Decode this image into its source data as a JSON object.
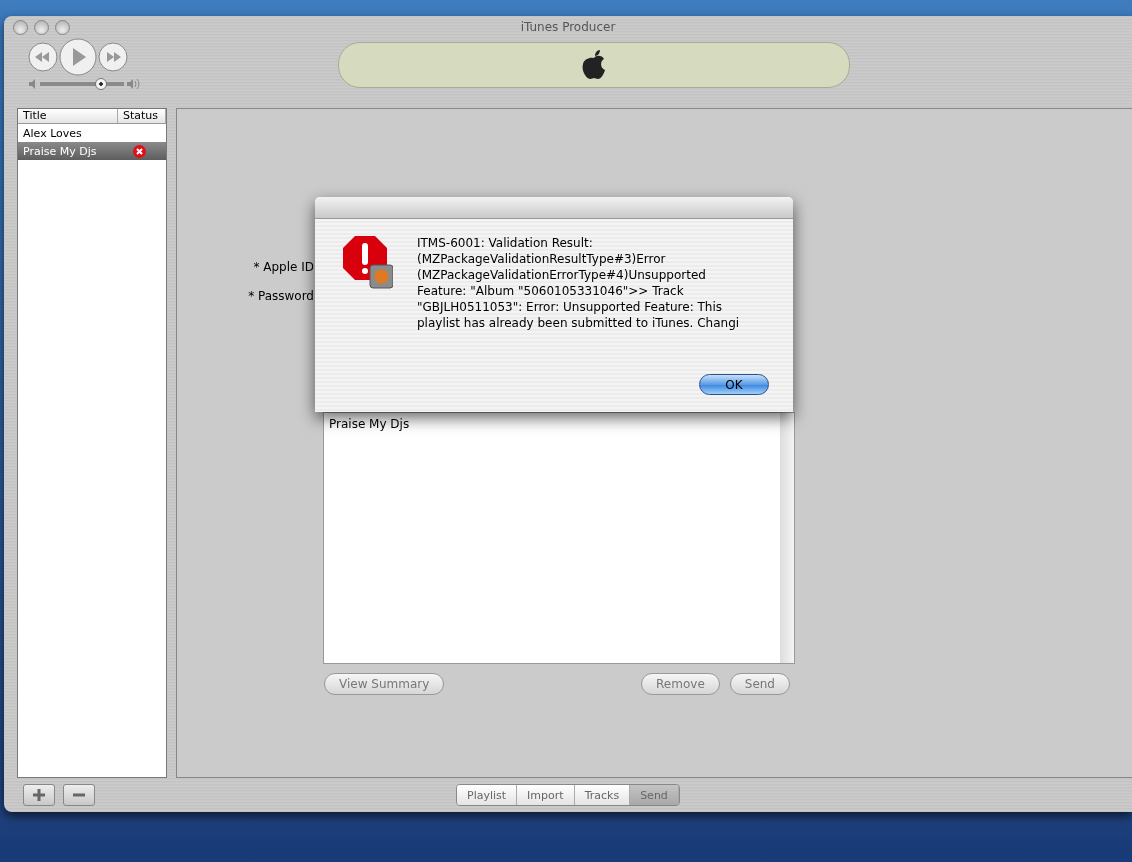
{
  "window": {
    "title": "iTunes Producer"
  },
  "volume": {
    "level": 0.73
  },
  "sidebar": {
    "columns": [
      "Title",
      "Status"
    ],
    "rows": [
      {
        "title": "Alex Loves",
        "error": false,
        "selected": false
      },
      {
        "title": "Praise My Djs",
        "error": true,
        "selected": true
      }
    ]
  },
  "form": {
    "fields": [
      {
        "label": "* Apple ID"
      },
      {
        "label": "* Password"
      }
    ]
  },
  "playlist_box": {
    "items": [
      "Praise My Djs"
    ]
  },
  "actions": {
    "left": [
      "View Summary"
    ],
    "right": [
      "Remove",
      "Send"
    ]
  },
  "bottom_tabs": [
    {
      "label": "Playlist",
      "selected": false
    },
    {
      "label": "Import",
      "selected": false
    },
    {
      "label": "Tracks",
      "selected": false
    },
    {
      "label": "Send",
      "selected": true
    }
  ],
  "dialog": {
    "message": "ITMS-6001: Validation Result: (MZPackageValidationResultType#3)Error (MZPackageValidationErrorType#4)Unsupported Feature: \"Album \"5060105331046\">> Track \"GBJLH0511053\": Error: Unsupported Feature: This playlist has already been submitted to iTunes. Changi",
    "buttons": [
      "OK"
    ]
  }
}
